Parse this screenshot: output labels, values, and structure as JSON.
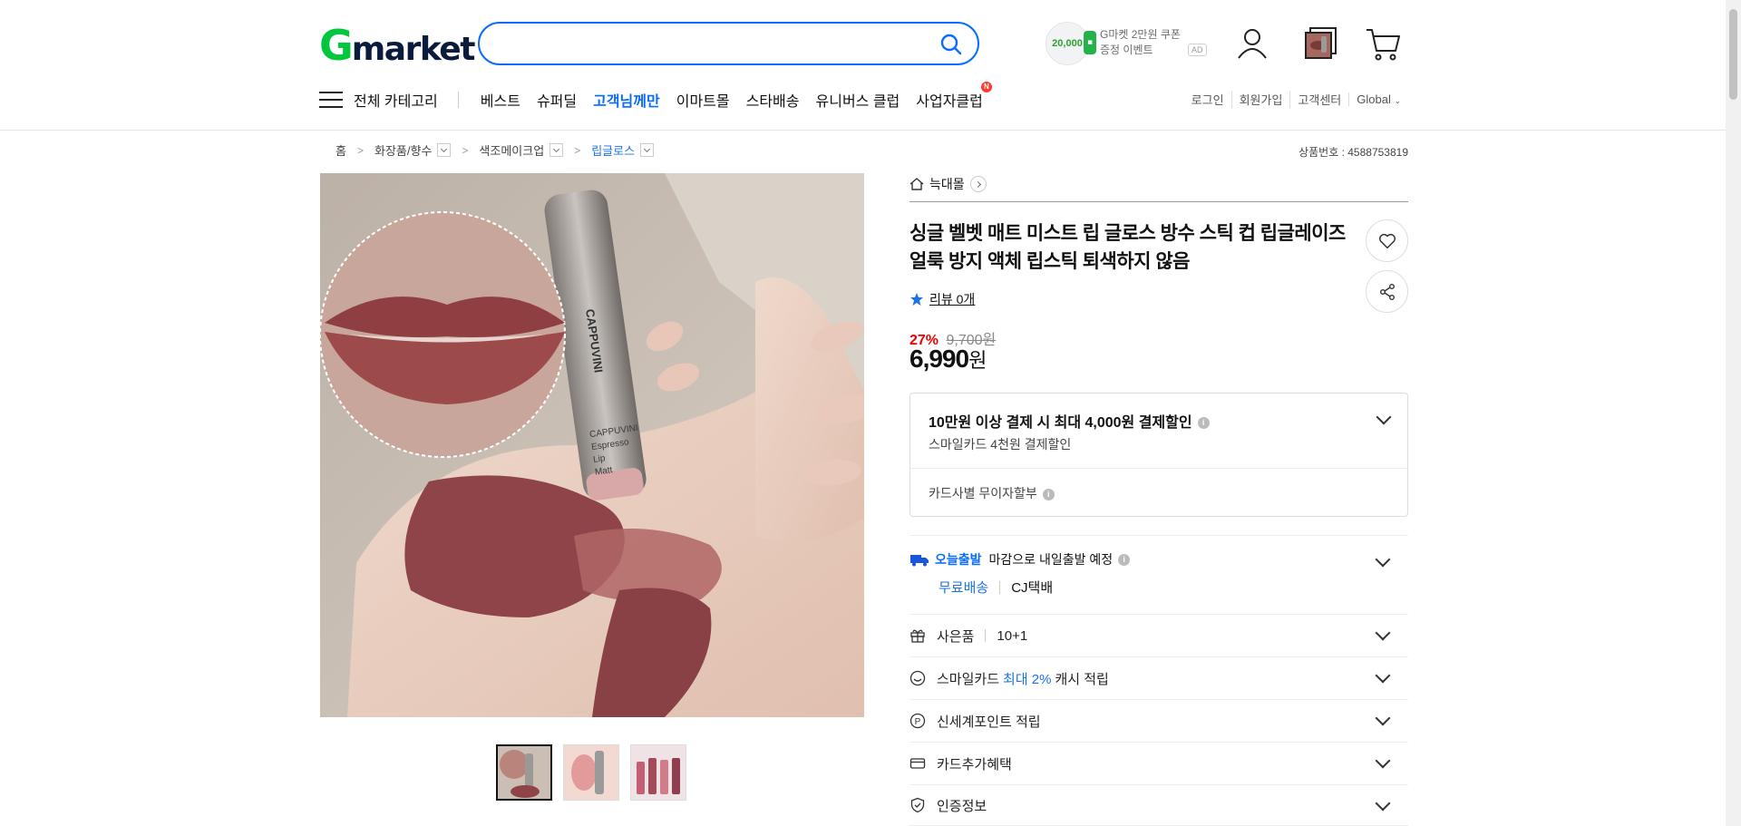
{
  "brand": {
    "logo_g": "G",
    "logo_rest": "market"
  },
  "search": {
    "placeholder": ""
  },
  "promo": {
    "coin_amount": "20,000",
    "text_line1": "G마켓 2만원 쿠폰",
    "text_line2": "증정 이벤트",
    "ad": "AD"
  },
  "nav": {
    "all_categories": "전체 카테고리",
    "items": [
      {
        "label": "베스트"
      },
      {
        "label": "슈퍼딜"
      },
      {
        "label": "고객님께만"
      },
      {
        "label": "이마트몰"
      },
      {
        "label": "스타배송"
      },
      {
        "label": "유니버스 클럽"
      },
      {
        "label": "사업자클럽"
      }
    ],
    "new_badge": "N"
  },
  "util": {
    "login": "로그인",
    "signup": "회원가입",
    "support": "고객센터",
    "global": "Global"
  },
  "breadcrumb": {
    "home": "홈",
    "cat1": "화장품/향수",
    "cat2": "색조메이크업",
    "cat3": "립글로스"
  },
  "product_no": "상품번호 : 4588753819",
  "shop_name": "늑대몰",
  "product_title": "싱글 벨벳 매트 미스트 립 글로스 방수 스틱 컵 립글레이즈 얼룩 방지 액체 립스틱 퇴색하지 않음",
  "review": {
    "label": "리뷰 0개"
  },
  "price": {
    "discount": "27%",
    "original": "9,700원",
    "sale_num": "6,990",
    "sale_unit": "원"
  },
  "card_box": {
    "title": "10만원 이상 결제 시 최대 4,000원 결제할인",
    "sub": "스마일카드 4천원 결제할인",
    "installment": "카드사별 무이자할부"
  },
  "shipping": {
    "today_label": "오늘출발",
    "deadline": "마감으로 내일출발 예정",
    "free": "무료배송",
    "carrier": "CJ택배"
  },
  "rows": {
    "gift_label": "사은품",
    "gift_value": "10+1",
    "smile_label": "스마일카드",
    "smile_blue": "최대 2%",
    "smile_tail": "캐시 적립",
    "point_label": "신세계포인트 적립",
    "card_extra": "카드추가혜택",
    "cert": "인증정보"
  },
  "colors": {
    "accent": "#0a6cff",
    "brand_green": "#00c73c",
    "discount_red": "#e00000"
  },
  "product_image": {
    "bottle_text": "CAPPUVINI",
    "label_text_1": "CAPPUVINI",
    "label_text_2": "Espresso",
    "label_text_3": "Lip",
    "label_text_4": "Matt"
  }
}
